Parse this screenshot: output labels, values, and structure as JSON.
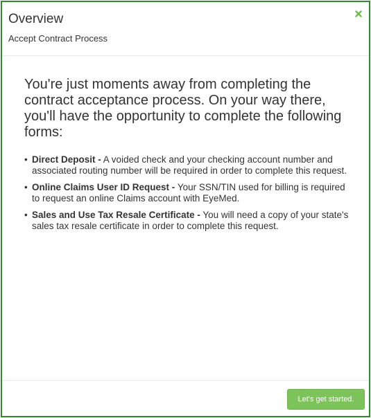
{
  "header": {
    "title": "Overview",
    "subtitle": "Accept Contract Process",
    "close_icon": "close-x-icon",
    "close_icon_color": "#6bbf4c"
  },
  "body": {
    "intro": "You're just moments away from completing the contract acceptance process. On your way there, you'll have the opportunity to complete the following forms:",
    "items": [
      {
        "term": "Direct Deposit -",
        "description": "A voided check and your checking account number and associated routing number will be required in order to complete this request."
      },
      {
        "term": "Online Claims User ID Request -",
        "description": "Your SSN/TIN used for billing is required to request an online Claims account with EyeMed."
      },
      {
        "term": "Sales and Use Tax Resale Certificate -",
        "description": "You will need a copy of your state's sales tax resale certificate in order to complete this request."
      }
    ]
  },
  "footer": {
    "start_label": "Let's get started."
  },
  "colors": {
    "border": "#2e8b2e",
    "accent": "#7cc45a",
    "text": "#333333"
  }
}
